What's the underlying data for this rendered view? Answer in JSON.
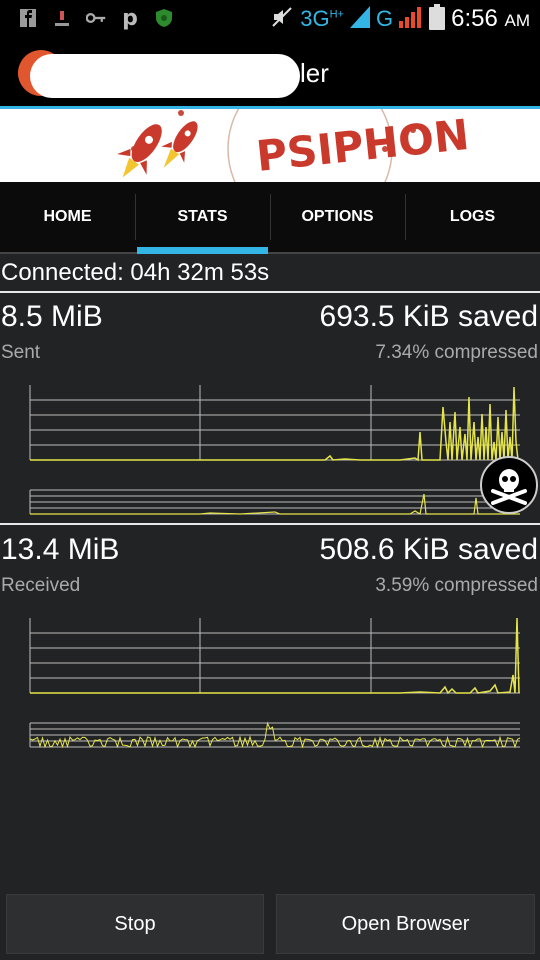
{
  "status_bar": {
    "network": "3G",
    "network_sup": "H+",
    "network2": "G",
    "time": "6:56",
    "ampm": "AM",
    "icons": [
      "facebook-icon",
      "download-icon",
      "key-icon",
      "p-icon",
      "shield-icon",
      "mute-icon",
      "signal-icon",
      "battery-icon"
    ]
  },
  "app": {
    "title_visible": "ler",
    "accent_color": "#33b5e5"
  },
  "banner": {
    "brand": "PSIPHON"
  },
  "tabs": [
    {
      "label": "HOME",
      "active": false
    },
    {
      "label": "STATS",
      "active": true
    },
    {
      "label": "OPTIONS",
      "active": false
    },
    {
      "label": "LOGS",
      "active": false
    }
  ],
  "stats": {
    "connected_text": "Connected: 04h 32m 53s",
    "sent": {
      "amount": "8.5 MiB",
      "label": "Sent",
      "saved": "693.5 KiB saved",
      "compressed": "7.34% compressed"
    },
    "received": {
      "amount": "13.4 MiB",
      "label": "Received",
      "saved": "508.6 KiB saved",
      "compressed": "3.59% compressed"
    }
  },
  "buttons": {
    "stop": "Stop",
    "open_browser": "Open Browser"
  },
  "colors": {
    "graph_line": "#e5e54a",
    "grid": "#bdbdbd",
    "background": "#222325"
  }
}
